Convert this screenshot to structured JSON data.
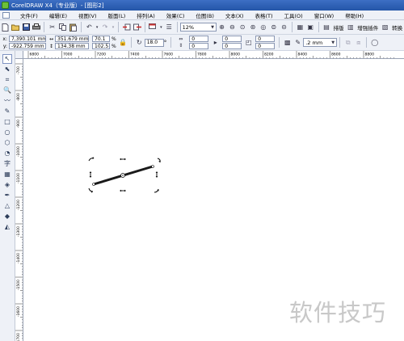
{
  "window": {
    "title": "CorelDRAW X4（专业版）- [图形2]"
  },
  "menu": {
    "items": [
      {
        "label": "文件(F)"
      },
      {
        "label": "编辑(E)"
      },
      {
        "label": "视图(V)"
      },
      {
        "label": "版面(L)"
      },
      {
        "label": "排列(A)"
      },
      {
        "label": "效果(C)"
      },
      {
        "label": "位图(B)"
      },
      {
        "label": "文本(X)"
      },
      {
        "label": "表格(T)"
      },
      {
        "label": "工具(O)"
      },
      {
        "label": "窗口(W)"
      },
      {
        "label": "帮助(H)"
      }
    ]
  },
  "toolbar": {
    "zoom_value": "12%",
    "typeset_label": "排版",
    "plugins_label": "增强插件",
    "convert_label": "转换"
  },
  "properties": {
    "x_label": "x:",
    "x_value": "7,390.101 mm",
    "y_label": "y:",
    "y_value": "-922.759 mm",
    "width_value": "351.679 mm",
    "height_value": "134.38 mm",
    "scale_x": "70.1",
    "scale_y": "102.5",
    "percent": "%",
    "rotation": "18.0",
    "degree": "°",
    "fields_a": [
      "0",
      "0"
    ],
    "fields_b": [
      "0",
      "0"
    ],
    "fields_c": [
      "0",
      "0"
    ],
    "outline_width": ".2 mm"
  },
  "ruler": {
    "h_labels": [
      "6800",
      "7000",
      "7200",
      "7400",
      "7600",
      "7800",
      "8000",
      "8200",
      "8400",
      "8600",
      "8800"
    ],
    "v_labels": [
      "-700",
      "-800",
      "-900",
      "-1000",
      "-1100",
      "-1200",
      "-1300",
      "-1400",
      "-1500",
      "-1600",
      "-1700"
    ]
  },
  "watermark": {
    "text": "软件技巧"
  },
  "colors": {
    "titlebar": "#2d5fb5",
    "panel": "#eef1f7",
    "line": "#1a1a1a"
  }
}
